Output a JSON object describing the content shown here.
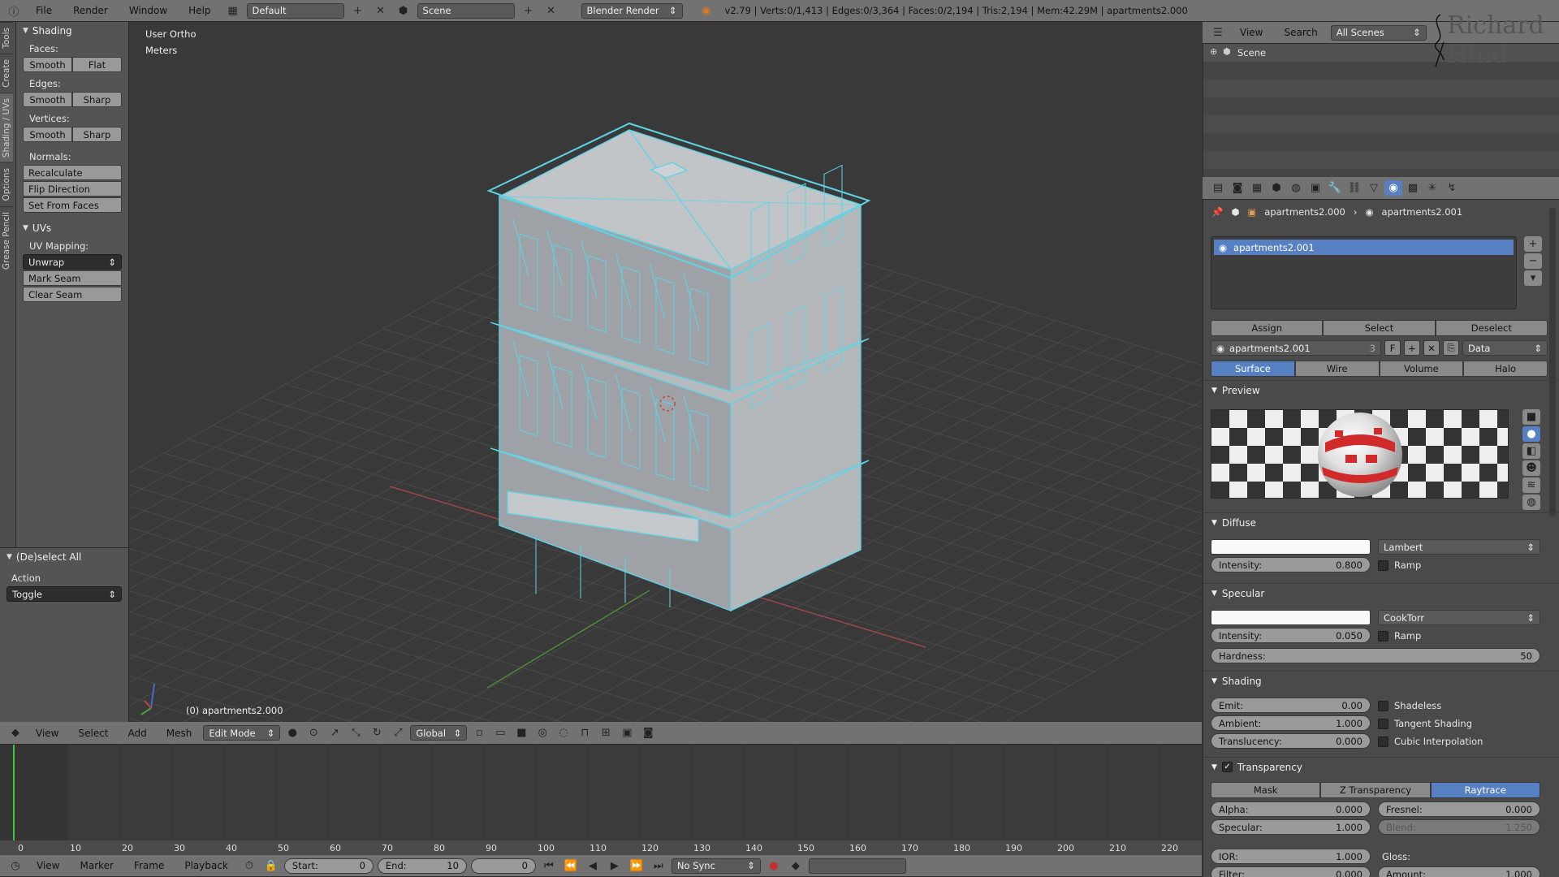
{
  "topbar": {
    "menus": [
      "File",
      "Render",
      "Window",
      "Help"
    ],
    "screen_layout": "Default",
    "scene": "Scene",
    "render_engine": "Blender Render",
    "stats": "v2.79 | Verts:0/1,413 | Edges:0/3,364 | Faces:0/2,194 | Tris:2,194 | Mem:42.29M | apartments2.000"
  },
  "tabs": [
    "Tools",
    "Create",
    "Shading / UVs",
    "Options",
    "Grease Pencil"
  ],
  "toolshelf": {
    "shading_title": "Shading",
    "faces_label": "Faces:",
    "edges_label": "Edges:",
    "vertices_label": "Vertices:",
    "smooth": "Smooth",
    "flat": "Flat",
    "sharp": "Sharp",
    "normals_label": "Normals:",
    "recalculate": "Recalculate",
    "flip_direction": "Flip Direction",
    "set_from_faces": "Set From Faces",
    "uvs_title": "UVs",
    "uv_mapping_label": "UV Mapping:",
    "unwrap": "Unwrap",
    "mark_seam": "Mark Seam",
    "clear_seam": "Clear Seam"
  },
  "operator": {
    "title": "(De)select All",
    "action_label": "Action",
    "action_value": "Toggle"
  },
  "viewport": {
    "view_name": "User Ortho",
    "units": "Meters",
    "object_name": "(0) apartments2.000",
    "mesh_color": "#a9adb1",
    "wire_color": "#5fd3e6"
  },
  "viewport_header": {
    "menus": [
      "View",
      "Select",
      "Add",
      "Mesh"
    ],
    "mode": "Edit Mode",
    "orientation": "Global"
  },
  "timeline": {
    "ticks": [
      "0",
      "10",
      "20",
      "30",
      "40",
      "50",
      "60",
      "70",
      "80",
      "90",
      "100",
      "110",
      "120",
      "130",
      "140",
      "150",
      "160",
      "170",
      "180",
      "190",
      "200",
      "210",
      "220"
    ],
    "menus": [
      "View",
      "Marker",
      "Frame",
      "Playback"
    ],
    "start_label": "Start:",
    "start_value": "0",
    "end_label": "End:",
    "end_value": "10",
    "current": "0",
    "sync": "No Sync"
  },
  "outliner": {
    "menus": [
      "View",
      "Search"
    ],
    "scenes_dropdown": "All Scenes",
    "item": "Scene",
    "watermark_line1": "Richard",
    "watermark_line2": "Hind"
  },
  "properties": {
    "breadcrumb_object": "apartments2.000",
    "breadcrumb_material": "apartments2.001",
    "slot_name": "apartments2.001",
    "assign": "Assign",
    "select": "Select",
    "deselect": "Deselect",
    "material_name": "apartments2.001",
    "users": "3",
    "fake_user": "F",
    "link": "Data",
    "tabs": [
      "Surface",
      "Wire",
      "Volume",
      "Halo"
    ],
    "preview_title": "Preview",
    "diffuse_title": "Diffuse",
    "diffuse_shader": "Lambert",
    "diffuse_intensity_label": "Intensity:",
    "diffuse_intensity": "0.800",
    "ramp": "Ramp",
    "specular_title": "Specular",
    "specular_shader": "CookTorr",
    "specular_intensity_label": "Intensity:",
    "specular_intensity": "0.050",
    "hardness_label": "Hardness:",
    "hardness": "50",
    "shading_title": "Shading",
    "emit_label": "Emit:",
    "emit": "0.00",
    "ambient_label": "Ambient:",
    "ambient": "1.000",
    "translucency_label": "Translucency:",
    "translucency": "0.000",
    "shadeless": "Shadeless",
    "tangent_shading": "Tangent Shading",
    "cubic_interpolation": "Cubic Interpolation",
    "transparency_title": "Transparency",
    "transparency_modes": [
      "Mask",
      "Z Transparency",
      "Raytrace"
    ],
    "alpha_label": "Alpha:",
    "alpha": "0.000",
    "fresnel_label": "Fresnel:",
    "fresnel": "0.000",
    "spec_label": "Specular:",
    "spec": "1.000",
    "blend_label": "Blend:",
    "blend": "1.250",
    "ior_label": "IOR:",
    "ior": "1.000",
    "gloss_label": "Gloss:",
    "filter_label": "Filter:",
    "filter": "0.000",
    "amount_label": "Amount:",
    "amount": "1.000"
  },
  "colors": {
    "accent": "#5680c2",
    "grid_x": "#b04848",
    "grid_y": "#5a9a3a",
    "playhead": "#3ec43e"
  }
}
